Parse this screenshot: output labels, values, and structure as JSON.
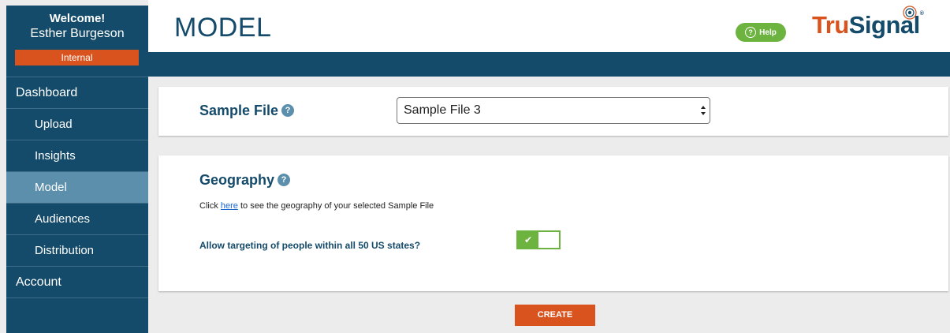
{
  "sidebar": {
    "welcome": "Welcome!",
    "user_name": "Esther Burgeson",
    "badge": "Internal",
    "items": [
      {
        "label": "Dashboard"
      },
      {
        "label": "Upload"
      },
      {
        "label": "Insights"
      },
      {
        "label": "Model"
      },
      {
        "label": "Audiences"
      },
      {
        "label": "Distribution"
      },
      {
        "label": "Account"
      }
    ]
  },
  "header": {
    "title": "MODEL",
    "help_label": "Help",
    "help_icon": "?",
    "logo_part1": "Tru",
    "logo_part2": "Signal",
    "logo_mark": "®"
  },
  "sample_file": {
    "label": "Sample File",
    "help_icon": "?",
    "selected": "Sample File 3"
  },
  "geography": {
    "label": "Geography",
    "help_icon": "?",
    "text_before": "Click ",
    "link_text": "here",
    "text_after": " to see the geography of your selected Sample File",
    "toggle_question": "Allow targeting of people within all 50 US states?",
    "toggle_on": true,
    "toggle_check": "✔"
  },
  "actions": {
    "create_label": "CREATE"
  },
  "colors": {
    "navy": "#144a6a",
    "orange": "#d9531e",
    "green": "#6db33f",
    "active_nav": "#5b8fac"
  }
}
